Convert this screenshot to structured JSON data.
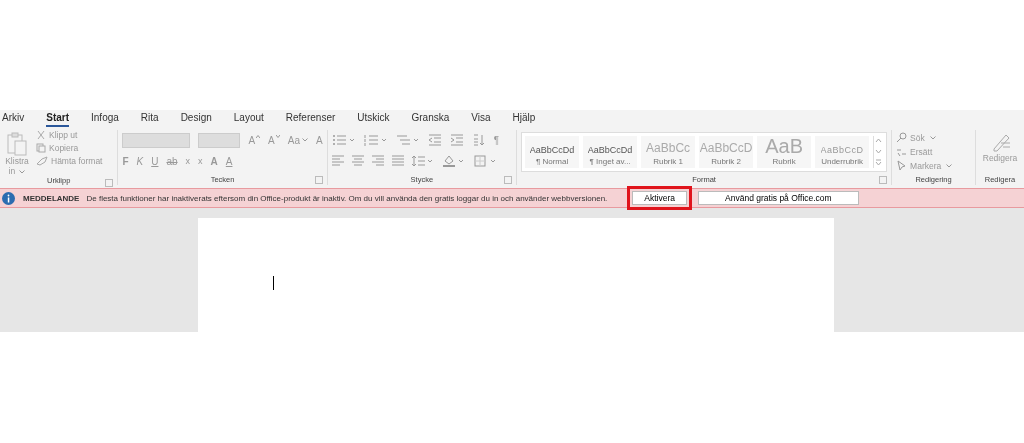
{
  "tabs": [
    {
      "label": "Arkiv",
      "selected": false
    },
    {
      "label": "Start",
      "selected": true
    },
    {
      "label": "Infoga",
      "selected": false
    },
    {
      "label": "Rita",
      "selected": false
    },
    {
      "label": "Design",
      "selected": false
    },
    {
      "label": "Layout",
      "selected": false
    },
    {
      "label": "Referenser",
      "selected": false
    },
    {
      "label": "Utskick",
      "selected": false
    },
    {
      "label": "Granska",
      "selected": false
    },
    {
      "label": "Visa",
      "selected": false
    },
    {
      "label": "Hjälp",
      "selected": false
    }
  ],
  "clipboard": {
    "paste": "Klistra",
    "paste_line2": "in",
    "items": [
      "Klipp ut",
      "Kopiera",
      "Hämta format"
    ],
    "label": "Urklipp"
  },
  "font": {
    "row1": [
      {
        "kind": "grow",
        "glyph": "A"
      },
      {
        "kind": "shrink",
        "glyph": "A"
      },
      {
        "kind": "case",
        "glyph": "Aa"
      },
      {
        "kind": "clear",
        "glyph": "A"
      }
    ],
    "row2": [
      {
        "kind": "bold",
        "glyph": "F"
      },
      {
        "kind": "italic",
        "glyph": "K"
      },
      {
        "kind": "underline",
        "glyph": "U"
      },
      {
        "kind": "strike",
        "glyph": "ab"
      },
      {
        "kind": "sub",
        "glyph": "x"
      },
      {
        "kind": "sup",
        "glyph": "x"
      },
      {
        "kind": "effects",
        "glyph": "A"
      },
      {
        "kind": "color",
        "glyph": "A"
      }
    ],
    "label": "Tecken"
  },
  "paragraph": {
    "pilcrow": "¶",
    "label": "Stycke"
  },
  "styles": {
    "items": [
      {
        "sample": "AaBbCcDd",
        "name": "¶ Normal",
        "kind": "normal"
      },
      {
        "sample": "AaBbCcDd",
        "name": "¶ Inget av...",
        "kind": "normal"
      },
      {
        "sample": "AaBbCc",
        "name": "Rubrik 1",
        "kind": "heading"
      },
      {
        "sample": "AaBbCcD",
        "name": "Rubrik 2",
        "kind": "heading"
      },
      {
        "sample": "AaB",
        "name": "Rubrik",
        "kind": "title"
      },
      {
        "sample": "AaBbCcD",
        "name": "Underrubrik",
        "kind": "subtitle"
      }
    ],
    "label": "Format"
  },
  "editing": {
    "items": [
      {
        "kind": "find",
        "label": "Sök"
      },
      {
        "kind": "replace",
        "label": "Ersätt"
      },
      {
        "kind": "select",
        "label": "Markera"
      }
    ],
    "label": "Redigering"
  },
  "editor": {
    "button": "Redigera",
    "label": "Redigera"
  },
  "banner": {
    "title": "MEDDELANDE",
    "message": "De flesta funktioner har inaktiverats eftersom din Office-produkt är inaktiv. Om du vill använda den gratis loggar du in och använder webbversionen.",
    "buttons": [
      {
        "label": "Aktivera",
        "highlighted": true
      },
      {
        "label": "Använd gratis på Office.com",
        "highlighted": false
      }
    ]
  }
}
